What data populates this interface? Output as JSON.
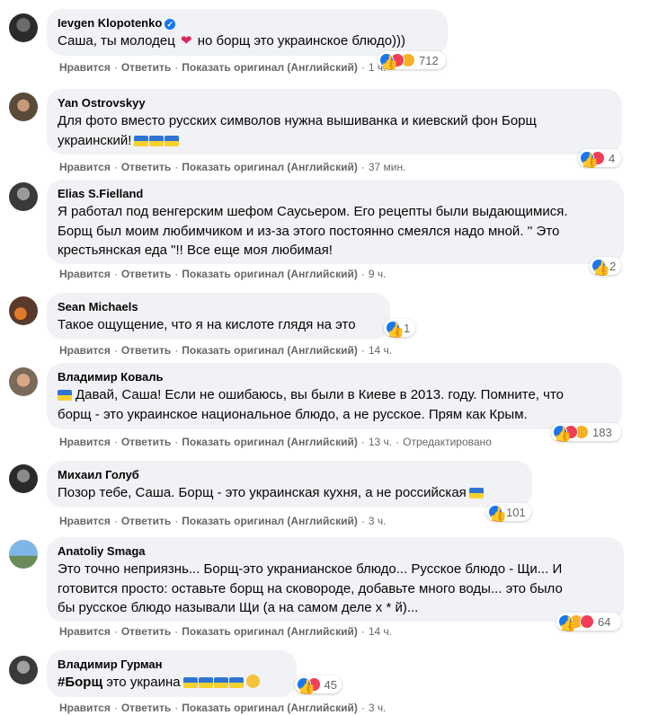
{
  "labels": {
    "like": "Нравится",
    "reply": "Ответить",
    "show_original": "Показать оригинал (Английский)",
    "edited": "Отредактировано"
  },
  "comments": [
    {
      "author": "Ievgen Klopotenko",
      "verified": true,
      "text_before": "Саша, ты молодец",
      "text_after": "но борщ это украинское блюдо)))",
      "reactions": [
        "like",
        "love",
        "care"
      ],
      "reaction_count": "712",
      "time": "1 ч."
    },
    {
      "author": "Yan Ostrovskyy",
      "line1": "Для фото вместо русских символов нужна вышиванка и киевский фон Борщ",
      "line2": "украинский!",
      "flags": 3,
      "reactions": [
        "like",
        "love"
      ],
      "reaction_count": "4",
      "time": "37 мин."
    },
    {
      "author": "Elias S.Fielland",
      "line1": "Я работал под венгерским шефом Саусьером. Его рецепты были выдающимися.",
      "line2": "Борщ был моим любимчиком и из-за этого постоянно смеялся надо мной. '' Это",
      "line3": "крестьянская еда \"!! Все еще моя любимая!",
      "reactions": [
        "like"
      ],
      "reaction_count": "2",
      "time": "9 ч."
    },
    {
      "author": "Sean Michaels",
      "line1": "Такое ощущение, что я на кислоте глядя на это",
      "reactions": [
        "like"
      ],
      "reaction_count": "1",
      "time": "14 ч."
    },
    {
      "author": "Владимир Коваль",
      "line1": "Давай, Саша! Если не ошибаюсь, вы были в Киеве в 2013. году. Помните, что",
      "line2": "борщ - это украинское национальное блюдо, а не русское. Прям как Крым.",
      "flags": 1,
      "reactions": [
        "like",
        "love",
        "haha"
      ],
      "reaction_count": "183",
      "time": "13 ч."
    },
    {
      "author": "Михаил Голуб",
      "line1": "Позор тебе, Саша. Борщ - это украинская кухня, а не российская",
      "flags": 1,
      "reactions": [
        "like"
      ],
      "reaction_count": "101",
      "time": "3 ч."
    },
    {
      "author": "Anatoliy Smaga",
      "line1": "Это точно неприязнь... Борщ-это укранианское блюдо... Русское блюдо - Щи... И",
      "line2": "готовится просто: оставьте борщ на сковороде, добавьте много воды... это было",
      "line3": "бы русское блюдо называли Щи (а на самом деле х * й)...",
      "reactions": [
        "like",
        "haha",
        "love"
      ],
      "reaction_count": "64",
      "time": "14 ч."
    },
    {
      "author": "Владимир Гурман",
      "hashtag": "#Борщ",
      "line1": "это украина",
      "flags": 4,
      "reactions": [
        "like",
        "love"
      ],
      "reaction_count": "45",
      "time": "3 ч."
    }
  ],
  "colors": {
    "bubble": "#f0f2f5",
    "meta": "#65676b",
    "like": "#1877f2",
    "love": "#f33e58",
    "haha": "#f7b125"
  }
}
